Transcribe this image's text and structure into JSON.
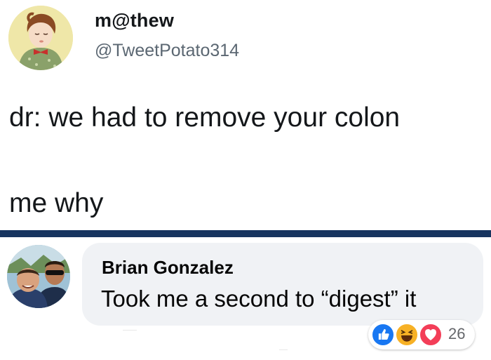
{
  "tweet": {
    "display_name": "m@thew",
    "handle": "@TweetPotato314",
    "lines": [
      "dr: we had to remove your colon",
      "me why"
    ]
  },
  "comment": {
    "author": "Brian Gonzalez",
    "text": "Took me a second to “digest” it",
    "reactions": {
      "types": [
        "like-icon",
        "haha-icon",
        "love-icon"
      ],
      "count": "26"
    }
  },
  "colors": {
    "divider": "#17345f",
    "bubble": "#f0f2f5",
    "like": "#1877f2",
    "haha": "#f7b125",
    "love": "#f33e58"
  }
}
